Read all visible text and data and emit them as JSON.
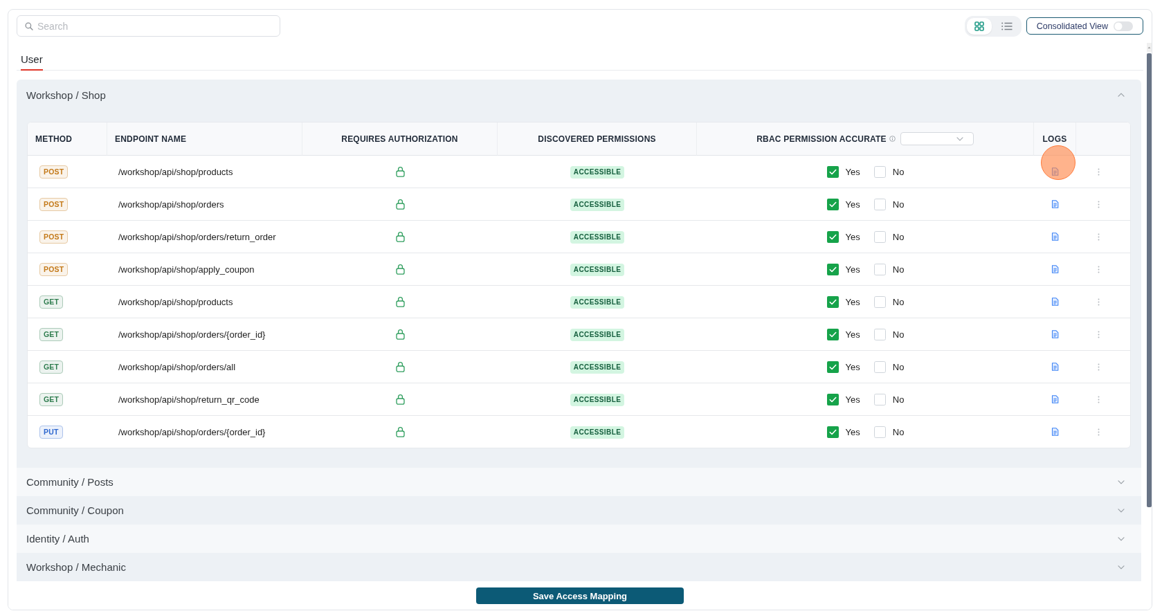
{
  "search": {
    "placeholder": "Search"
  },
  "view_toggle": [
    {
      "kind": "grid",
      "selected": true
    },
    {
      "kind": "list",
      "selected": false
    }
  ],
  "consolidated_view": {
    "label": "Consolidated View",
    "on": false
  },
  "tabs": [
    {
      "label": "User",
      "selected": true
    }
  ],
  "groups": [
    {
      "title": "Workshop / Shop",
      "expanded": true,
      "columns": [
        {
          "label": "METHOD",
          "kind": "start"
        },
        {
          "label": "ENDPOINT NAME",
          "kind": "start"
        },
        {
          "label": "REQUIRES AUTHORIZATION",
          "kind": "center"
        },
        {
          "label": "DISCOVERED PERMISSIONS",
          "kind": "center"
        },
        {
          "label": "RBAC PERMISSION ACCURATE",
          "kind": "filter"
        },
        {
          "label": "LOGS",
          "kind": "center"
        }
      ],
      "rows": [
        {
          "method": {
            "label": "POST",
            "color": "#c47a1a"
          },
          "endpoint": "/workshop/api/shop/products",
          "requires_authorization": true,
          "discovered_permission": "ACCESSIBLE",
          "rbac_accurate": [
            {
              "label": "Yes",
              "checked": true
            },
            {
              "label": "No",
              "checked": false
            }
          ],
          "click_highlight": true
        },
        {
          "method": {
            "label": "POST",
            "color": "#c47a1a"
          },
          "endpoint": "/workshop/api/shop/orders",
          "requires_authorization": true,
          "discovered_permission": "ACCESSIBLE",
          "rbac_accurate": [
            {
              "label": "Yes",
              "checked": true
            },
            {
              "label": "No",
              "checked": false
            }
          ],
          "click_highlight": false
        },
        {
          "method": {
            "label": "POST",
            "color": "#c47a1a"
          },
          "endpoint": "/workshop/api/shop/orders/return_order",
          "requires_authorization": true,
          "discovered_permission": "ACCESSIBLE",
          "rbac_accurate": [
            {
              "label": "Yes",
              "checked": true
            },
            {
              "label": "No",
              "checked": false
            }
          ],
          "click_highlight": false
        },
        {
          "method": {
            "label": "POST",
            "color": "#c47a1a"
          },
          "endpoint": "/workshop/api/shop/apply_coupon",
          "requires_authorization": true,
          "discovered_permission": "ACCESSIBLE",
          "rbac_accurate": [
            {
              "label": "Yes",
              "checked": true
            },
            {
              "label": "No",
              "checked": false
            }
          ],
          "click_highlight": false
        },
        {
          "method": {
            "label": "GET",
            "color": "#2f7d4f"
          },
          "endpoint": "/workshop/api/shop/products",
          "requires_authorization": true,
          "discovered_permission": "ACCESSIBLE",
          "rbac_accurate": [
            {
              "label": "Yes",
              "checked": true
            },
            {
              "label": "No",
              "checked": false
            }
          ],
          "click_highlight": false
        },
        {
          "method": {
            "label": "GET",
            "color": "#2f7d4f"
          },
          "endpoint": "/workshop/api/shop/orders/{order_id}",
          "requires_authorization": true,
          "discovered_permission": "ACCESSIBLE",
          "rbac_accurate": [
            {
              "label": "Yes",
              "checked": true
            },
            {
              "label": "No",
              "checked": false
            }
          ],
          "click_highlight": false
        },
        {
          "method": {
            "label": "GET",
            "color": "#2f7d4f"
          },
          "endpoint": "/workshop/api/shop/orders/all",
          "requires_authorization": true,
          "discovered_permission": "ACCESSIBLE",
          "rbac_accurate": [
            {
              "label": "Yes",
              "checked": true
            },
            {
              "label": "No",
              "checked": false
            }
          ],
          "click_highlight": false
        },
        {
          "method": {
            "label": "GET",
            "color": "#2f7d4f"
          },
          "endpoint": "/workshop/api/shop/return_qr_code",
          "requires_authorization": true,
          "discovered_permission": "ACCESSIBLE",
          "rbac_accurate": [
            {
              "label": "Yes",
              "checked": true
            },
            {
              "label": "No",
              "checked": false
            }
          ],
          "click_highlight": false
        },
        {
          "method": {
            "label": "PUT",
            "color": "#2f68cf"
          },
          "endpoint": "/workshop/api/shop/orders/{order_id}",
          "requires_authorization": true,
          "discovered_permission": "ACCESSIBLE",
          "rbac_accurate": [
            {
              "label": "Yes",
              "checked": true
            },
            {
              "label": "No",
              "checked": false
            }
          ],
          "click_highlight": false
        }
      ]
    },
    {
      "title": "Community / Posts",
      "expanded": false
    },
    {
      "title": "Community / Coupon",
      "expanded": false
    },
    {
      "title": "Identity / Auth",
      "expanded": false
    },
    {
      "title": "Workshop / Mechanic",
      "expanded": false
    }
  ],
  "save_button": "Save Access Mapping"
}
